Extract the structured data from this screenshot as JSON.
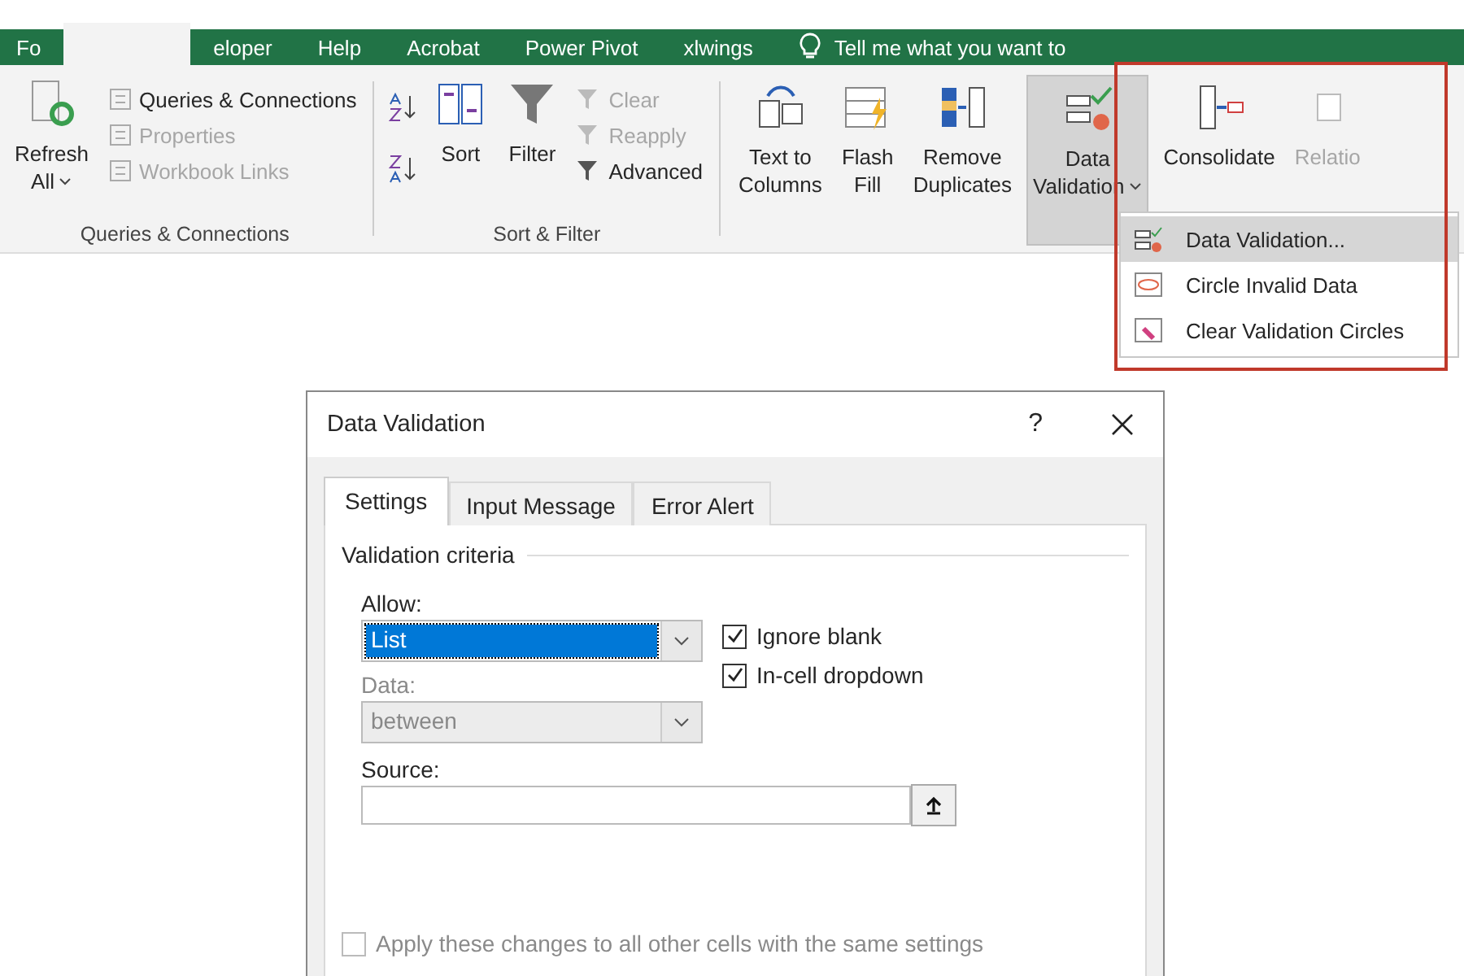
{
  "tabs": [
    {
      "label": "Fo",
      "selected": false
    },
    {
      "selected": true
    },
    {
      "label": "eloper",
      "selected": false
    },
    {
      "label": "Help",
      "selected": false
    },
    {
      "label": "Acrobat",
      "selected": false
    },
    {
      "label": "Power Pivot",
      "selected": false
    },
    {
      "label": "xlwings",
      "selected": false
    }
  ],
  "tell_me": "Tell me what you want to",
  "queries": {
    "refresh": [
      "Refresh",
      "All"
    ],
    "label": "Queries & Connections",
    "items": [
      {
        "label": "Queries & Connections",
        "disabled": false
      },
      {
        "label": "Properties",
        "disabled": true
      },
      {
        "label": "Workbook Links",
        "disabled": true
      }
    ]
  },
  "sort_filter": {
    "sort": "Sort",
    "filter": "Filter",
    "label": "Sort & Filter",
    "items": [
      {
        "label": "Clear",
        "disabled": true
      },
      {
        "label": "Reapply",
        "disabled": true
      },
      {
        "label": "Advanced",
        "disabled": false
      }
    ]
  },
  "data_tools": [
    {
      "kind": "text-columns",
      "lines": [
        "Text to",
        "Columns"
      ],
      "selected": false,
      "disabled": false
    },
    {
      "kind": "flash-fill",
      "lines": [
        "Flash",
        "Fill"
      ],
      "selected": false,
      "disabled": false
    },
    {
      "kind": "remove-duplicates",
      "lines": [
        "Remove",
        "Duplicates"
      ],
      "selected": false,
      "disabled": false
    },
    {
      "kind": "validation",
      "lines": [
        "Data",
        "Validation"
      ],
      "dropdown": true,
      "selected": true,
      "disabled": false
    },
    {
      "kind": "consolidate",
      "lines": [
        "Consolidate"
      ],
      "selected": false,
      "disabled": false
    },
    {
      "kind": "relations",
      "lines": [
        "Relatio"
      ],
      "selected": false,
      "disabled": true
    }
  ],
  "menu": [
    {
      "kind": "validation",
      "label": "Data Validation...",
      "selected": true
    },
    {
      "kind": "circle",
      "label": "Circle Invalid Data",
      "selected": false
    },
    {
      "kind": "clear",
      "label": "Clear Validation Circles",
      "selected": false
    }
  ],
  "dialog": {
    "title": "Data Validation",
    "help": "?",
    "tabs": [
      {
        "label": "Settings",
        "selected": true
      },
      {
        "label": "Input Message",
        "selected": false
      },
      {
        "label": "Error Alert",
        "selected": false
      }
    ],
    "section": "Validation criteria",
    "allow": {
      "label": "Allow:",
      "value": "List",
      "disabled": false
    },
    "data": {
      "label": "Data:",
      "value": "between",
      "disabled": true
    },
    "checks": [
      {
        "label": "Ignore blank",
        "checked": true
      },
      {
        "label": "In-cell dropdown",
        "checked": true
      }
    ],
    "source": {
      "label": "Source:"
    },
    "apply": {
      "label": "Apply these changes to all other cells with the same settings",
      "checked": false,
      "disabled": true
    }
  }
}
